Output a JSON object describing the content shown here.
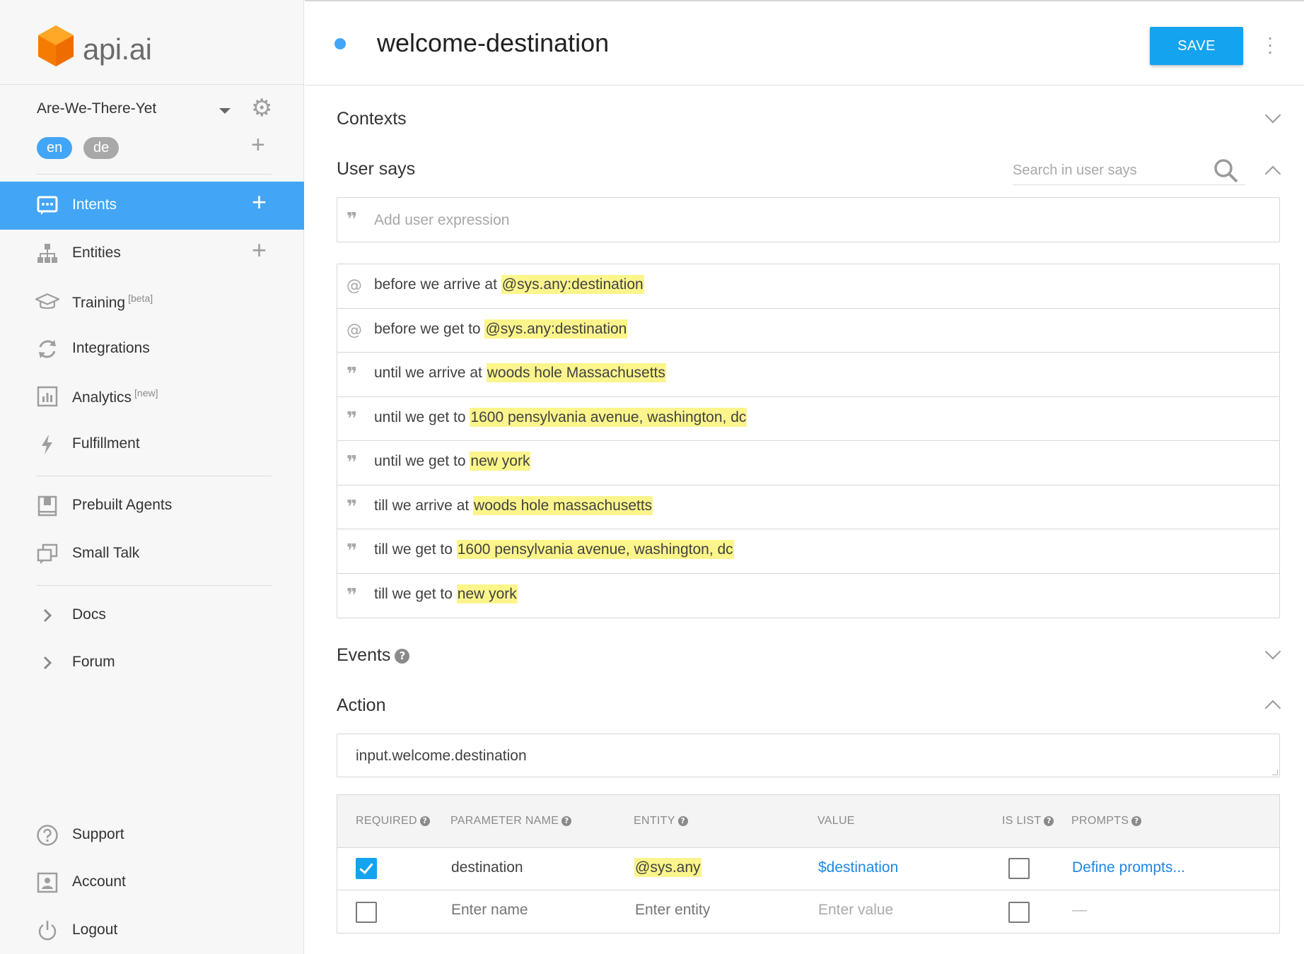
{
  "brand": {
    "name": "api.ai"
  },
  "agent": {
    "name": "Are-We-There-Yet",
    "languages": [
      "en",
      "de"
    ]
  },
  "nav": {
    "intents": {
      "label": "Intents"
    },
    "entities": {
      "label": "Entities"
    },
    "training": {
      "label": "Training",
      "tag": "[beta]"
    },
    "integrations": {
      "label": "Integrations"
    },
    "analytics": {
      "label": "Analytics",
      "tag": "[new]"
    },
    "fulfillment": {
      "label": "Fulfillment"
    },
    "prebuilt_agents": {
      "label": "Prebuilt Agents"
    },
    "small_talk": {
      "label": "Small Talk"
    },
    "docs": {
      "label": "Docs"
    },
    "forum": {
      "label": "Forum"
    },
    "support": {
      "label": "Support"
    },
    "account": {
      "label": "Account"
    },
    "logout": {
      "label": "Logout"
    }
  },
  "header": {
    "intent_name": "welcome-destination",
    "save_label": "SAVE"
  },
  "sections": {
    "contexts": "Contexts",
    "user_says": "User says",
    "events": "Events",
    "action": "Action"
  },
  "search": {
    "placeholder": "Search in user says"
  },
  "add_expression": {
    "placeholder": "Add user expression"
  },
  "expressions": [
    {
      "icon": "template",
      "prefix": "before we arrive at ",
      "highlight": "@sys.any:destination"
    },
    {
      "icon": "template",
      "prefix": "before we get to ",
      "highlight": "@sys.any:destination"
    },
    {
      "icon": "example",
      "prefix": "until we arrive at ",
      "highlight": "woods hole Massachusetts"
    },
    {
      "icon": "example",
      "prefix": "until we get to ",
      "highlight": "1600 pensylvania avenue, washington, dc"
    },
    {
      "icon": "example",
      "prefix": "until we get to ",
      "highlight": "new york"
    },
    {
      "icon": "example",
      "prefix": "till we arrive at ",
      "highlight": "woods hole massachusetts"
    },
    {
      "icon": "example",
      "prefix": "till we get to ",
      "highlight": "1600 pensylvania avenue, washington, dc"
    },
    {
      "icon": "example",
      "prefix": "till we get to ",
      "highlight": "new york"
    }
  ],
  "action": {
    "value": "input.welcome.destination"
  },
  "params_table": {
    "headers": {
      "required": "REQUIRED",
      "parameter_name": "PARAMETER NAME",
      "entity": "ENTITY",
      "value": "VALUE",
      "is_list": "IS LIST",
      "prompts": "PROMPTS"
    },
    "rows": [
      {
        "required": true,
        "name": "destination",
        "entity": "@sys.any",
        "value": "$destination",
        "is_list": false,
        "prompts": "Define prompts..."
      }
    ],
    "new_row": {
      "required": false,
      "name_placeholder": "Enter name",
      "entity_placeholder": "Enter entity",
      "value_placeholder": "Enter value",
      "is_list": false,
      "prompts": "—"
    }
  },
  "colors": {
    "accent": "#42a5f5",
    "save_button": "#14a3ee",
    "highlight": "#fbf58c",
    "logo_orange": "#f57c00",
    "link": "#1e88e5"
  },
  "icons": {
    "intents": "chat-bubble-icon",
    "entities": "sitemap-icon",
    "training": "graduation-cap-icon",
    "integrations": "refresh-icon",
    "analytics": "bar-chart-icon",
    "fulfillment": "lightning-icon",
    "prebuilt_agents": "book-icon",
    "small_talk": "chat-squares-icon",
    "support": "question-circle-icon",
    "account": "person-card-icon",
    "logout": "power-icon"
  }
}
